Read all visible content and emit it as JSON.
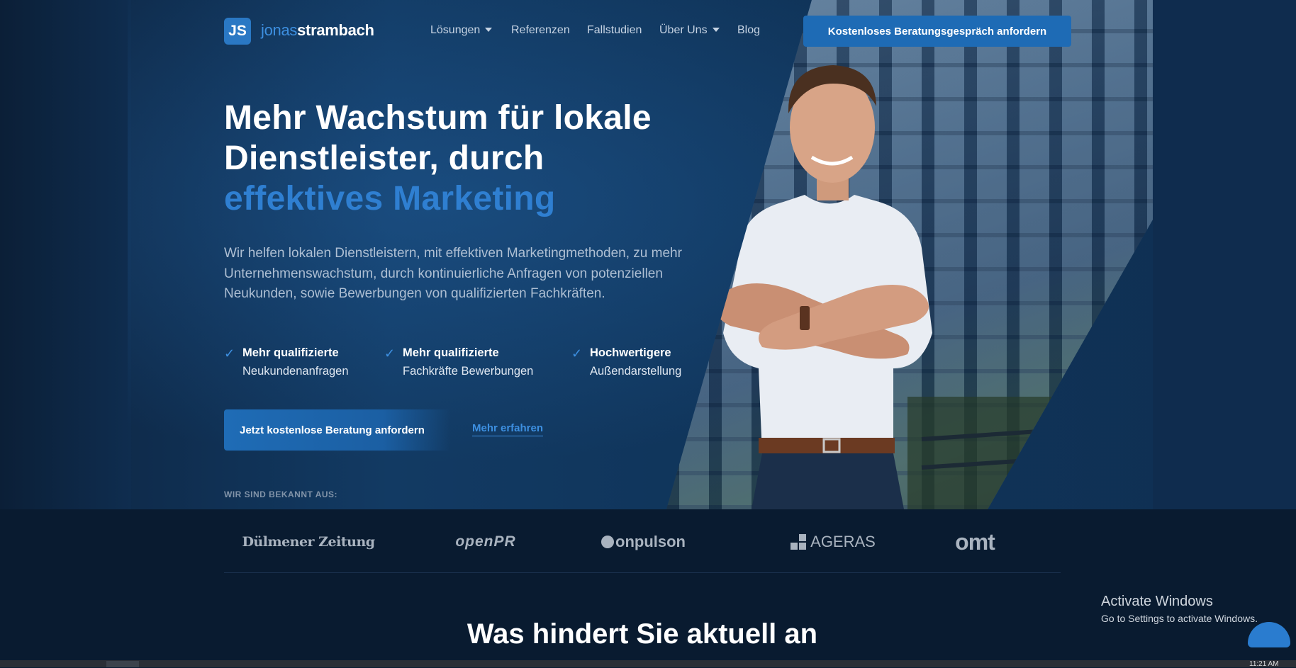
{
  "nav": {
    "logo_badge": "JS",
    "logo_first": "jonas",
    "logo_last": "strambach",
    "items": [
      {
        "label": "Lösungen",
        "dropdown": true
      },
      {
        "label": "Referenzen",
        "dropdown": false
      },
      {
        "label": "Fallstudien",
        "dropdown": false
      },
      {
        "label": "Über Uns",
        "dropdown": true
      },
      {
        "label": "Blog",
        "dropdown": false
      }
    ],
    "cta": "Kostenloses Beratungsgespräch anfordern"
  },
  "hero": {
    "headline_line1": "Mehr Wachstum für lokale",
    "headline_line2": "Dienstleister, durch",
    "headline_accent": "effektives Marketing",
    "lead": "Wir helfen lokalen Dienstleistern, mit effektiven Marketingmethoden, zu mehr Unternehmenswachstum, durch kontinuierliche Anfragen von potenziellen Neukunden, sowie Bewerbungen von qualifizierten Fachkräften.",
    "features": [
      {
        "title": "Mehr qualifizierte",
        "subtitle": "Neukundenanfragen"
      },
      {
        "title": "Mehr qualifizierte",
        "subtitle": "Fachkräfte Bewerbungen"
      },
      {
        "title": "Hochwertigere",
        "subtitle": "Außendarstellung"
      }
    ],
    "primary_button": "Jetzt kostenlose Beratung anfordern",
    "secondary_link": "Mehr erfahren",
    "known_from": "WIR SIND BEKANNT AUS:"
  },
  "press": {
    "dz": "Dülmener Zeitung",
    "openpr": "openPR",
    "onpulson": "onpulson",
    "ageras": "AGERAS",
    "omt": "omt"
  },
  "section2": {
    "title": "Was hindert Sie aktuell an"
  },
  "windows": {
    "activate_title": "Activate Windows",
    "activate_sub": "Go to Settings to activate Windows.",
    "time": "11:21 AM"
  },
  "colors": {
    "accent": "#2f7fd1",
    "cta": "#1e6bb5",
    "hero_bg": "#10355b",
    "band_bg": "#091b30"
  }
}
